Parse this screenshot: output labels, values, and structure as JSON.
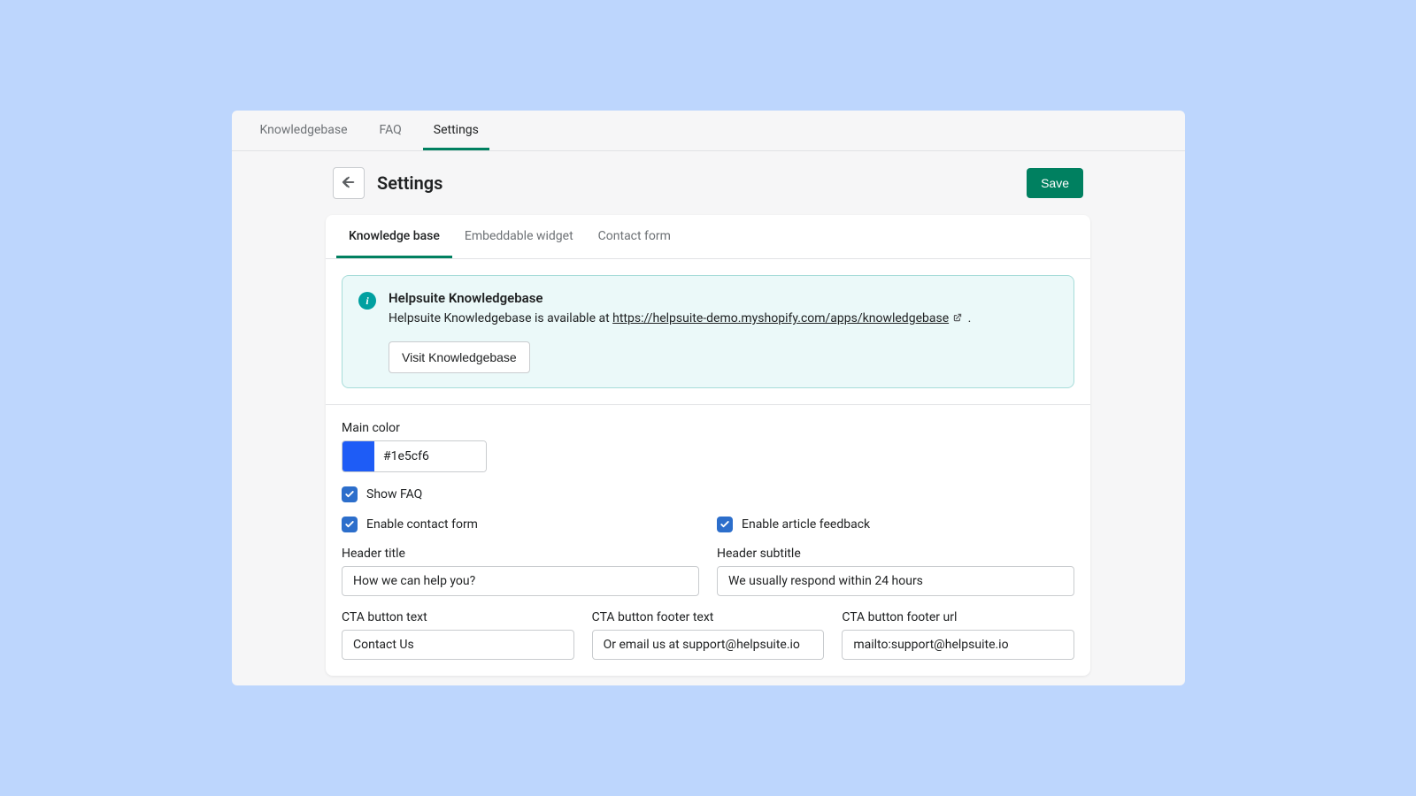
{
  "top_tabs": {
    "knowledgebase": "Knowledgebase",
    "faq": "FAQ",
    "settings": "Settings"
  },
  "header": {
    "title": "Settings",
    "save": "Save"
  },
  "inner_tabs": {
    "kb": "Knowledge base",
    "widget": "Embeddable widget",
    "contact": "Contact form"
  },
  "banner": {
    "title": "Helpsuite Knowledgebase",
    "prefix": "Helpsuite Knowledgebase is available at ",
    "url": "https://helpsuite-demo.myshopify.com/apps/knowledgebase",
    "suffix": " .",
    "visit": "Visit Knowledgebase"
  },
  "form": {
    "main_color_label": "Main color",
    "main_color": "#1e5cf6",
    "show_faq": "Show FAQ",
    "enable_contact": "Enable contact form",
    "enable_feedback": "Enable article feedback",
    "header_title_label": "Header title",
    "header_title": "How we can help you?",
    "header_subtitle_label": "Header subtitle",
    "header_subtitle": "We usually respond within 24 hours",
    "cta_text_label": "CTA button text",
    "cta_text": "Contact Us",
    "cta_footer_text_label": "CTA button footer text",
    "cta_footer_text": "Or email us at support@helpsuite.io",
    "cta_footer_url_label": "CTA button footer url",
    "cta_footer_url": "mailto:support@helpsuite.io"
  }
}
